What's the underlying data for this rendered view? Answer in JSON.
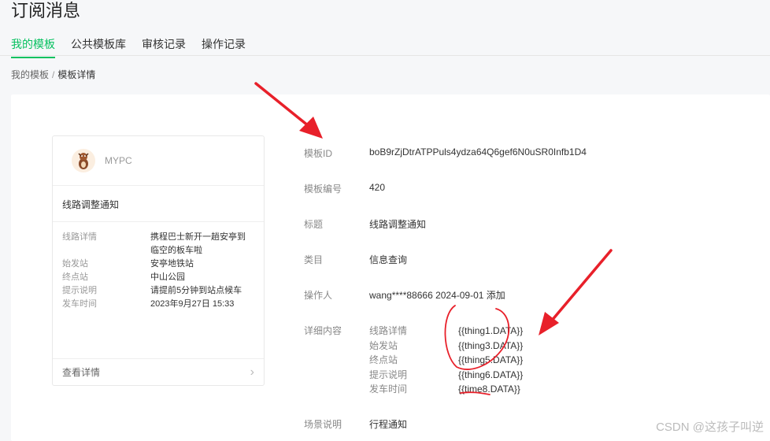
{
  "page": {
    "title": "订阅消息"
  },
  "tabs": [
    {
      "label": "我的模板",
      "active": true
    },
    {
      "label": "公共模板库",
      "active": false
    },
    {
      "label": "审核记录",
      "active": false
    },
    {
      "label": "操作记录",
      "active": false
    }
  ],
  "breadcrumb": {
    "parent": "我的模板",
    "separator": "/",
    "current": "模板详情"
  },
  "preview": {
    "account_name": "MYPC",
    "title": "线路调整通知",
    "fields": [
      {
        "label": "线路详情",
        "value": "携程巴士新开一趟安亭到临空的板车啦"
      },
      {
        "label": "始发站",
        "value": "安亭地铁站"
      },
      {
        "label": "终点站",
        "value": "中山公园"
      },
      {
        "label": "提示说明",
        "value": "请提前5分钟到站点候车"
      },
      {
        "label": "发车时间",
        "value": "2023年9月27日 15:33"
      }
    ],
    "more_label": "查看详情"
  },
  "detail": {
    "template_id": {
      "label": "模板ID",
      "value": "boB9rZjDtrATPPuls4ydza64Q6gef6N0uSR0Infb1D4"
    },
    "template_no": {
      "label": "模板编号",
      "value": "420"
    },
    "title": {
      "label": "标题",
      "value": "线路调整通知"
    },
    "category": {
      "label": "类目",
      "value": "信息查询"
    },
    "operator": {
      "label": "操作人",
      "value": "wang****88666 2024-09-01 添加"
    },
    "content": {
      "label": "详细内容",
      "rows": [
        {
          "key": "线路详情",
          "var": "{{thing1.DATA}}"
        },
        {
          "key": "始发站",
          "var": "{{thing3.DATA}}"
        },
        {
          "key": "终点站",
          "var": "{{thing5.DATA}}"
        },
        {
          "key": "提示说明",
          "var": "{{thing6.DATA}}"
        },
        {
          "key": "发车时间",
          "var": "{{time8.DATA}}"
        }
      ]
    },
    "scene": {
      "label": "场景说明",
      "value": "行程通知"
    }
  },
  "watermark": "CSDN @这孩子叫逆",
  "colors": {
    "accent": "#07c160",
    "annotation": "#e8202a"
  }
}
